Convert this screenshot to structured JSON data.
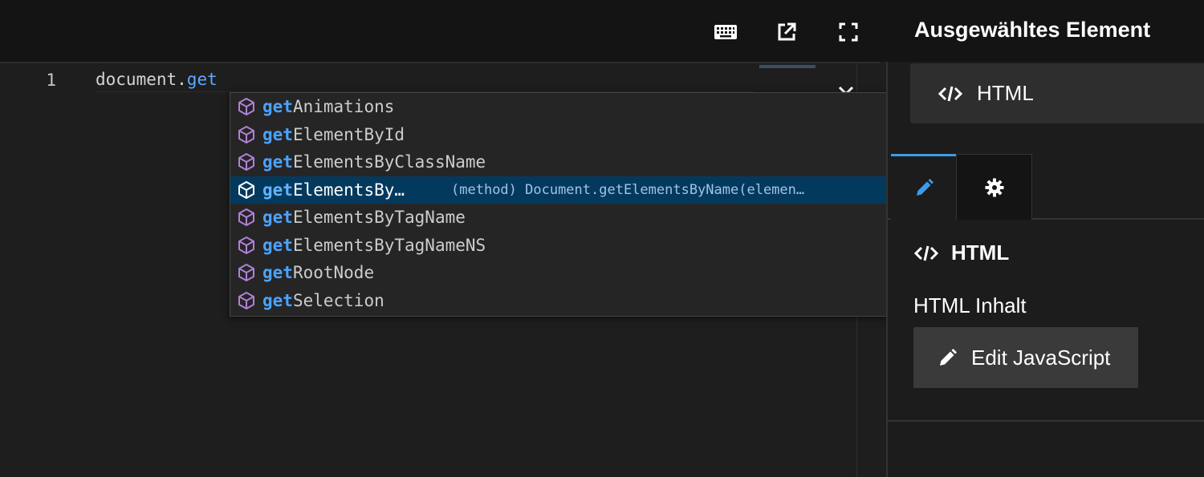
{
  "toolbar": {
    "icons": [
      "keyboard-icon",
      "external-link-icon",
      "fullscreen-icon"
    ]
  },
  "editor": {
    "line_number": "1",
    "code_object": "document.",
    "code_property": "get"
  },
  "suggestions": {
    "match_prefix": "get",
    "items": [
      {
        "rest": "Animations"
      },
      {
        "rest": "ElementById"
      },
      {
        "rest": "ElementsByClassName"
      },
      {
        "rest": "ElementsBy…",
        "detail": "(method) Document.getElementsByName(elemen…",
        "selected": true
      },
      {
        "rest": "ElementsByTagName"
      },
      {
        "rest": "ElementsByTagNameNS"
      },
      {
        "rest": "RootNode"
      },
      {
        "rest": "Selection"
      }
    ]
  },
  "panel": {
    "title": "Ausgewähltes Element",
    "selected_element": "HTML",
    "section_title": "HTML",
    "field_label": "HTML Inhalt",
    "edit_button": "Edit JavaScript"
  },
  "colors": {
    "accent": "#3d9be9",
    "selection": "#04395e",
    "method_icon": "#b180d7"
  }
}
